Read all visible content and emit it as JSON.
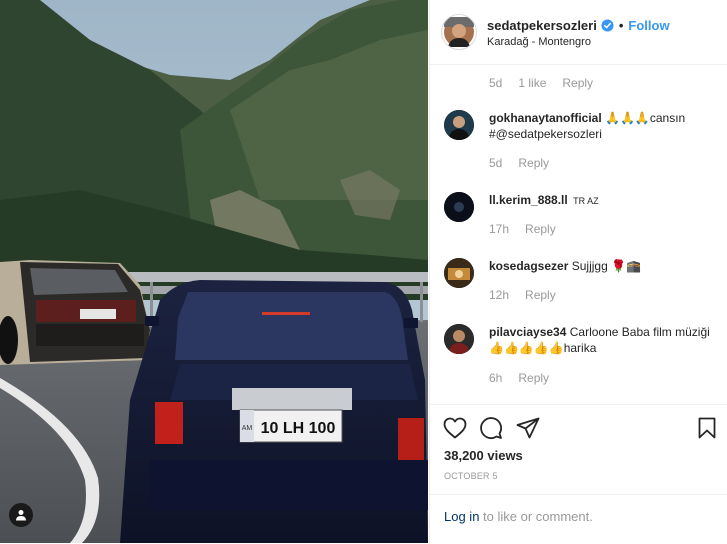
{
  "post": {
    "author": "sedatpekersozleri",
    "follow_label": "Follow",
    "location": "Karadağ - Montengro",
    "plate_text": "10 LH 100",
    "plate_country": "AM"
  },
  "first_comment_meta": {
    "time": "5d",
    "likes": "1 like",
    "reply": "Reply"
  },
  "comments": [
    {
      "user": "gokhanaytanofficial",
      "text": "🙏🙏🙏cansın #@sedatpekersozleri",
      "time": "5d",
      "reply": "Reply"
    },
    {
      "user": "ll.kerim_888.ll",
      "small": "TR AZ",
      "time": "17h",
      "reply": "Reply"
    },
    {
      "user": "kosedagsezer",
      "text": "Sujjjgg 🌹🕋",
      "time": "12h",
      "reply": "Reply"
    },
    {
      "user": "pilavciayse34",
      "text": "Carloone Baba film müziği👍👍👍👍👍harika",
      "time": "6h",
      "reply": "Reply"
    }
  ],
  "stats": {
    "views": "38,200 views",
    "date": "OCTOBER 5"
  },
  "login": {
    "link": "Log in",
    "rest": " to like or comment."
  },
  "icons": {
    "like": "heart-icon",
    "comment": "speech-bubble-icon",
    "share": "paper-plane-icon",
    "save": "bookmark-icon",
    "tag": "user-tag-icon",
    "verified": "verified-badge-icon"
  },
  "colors": {
    "link_blue": "#3897f0",
    "login_blue": "#003569",
    "muted": "#999999"
  }
}
